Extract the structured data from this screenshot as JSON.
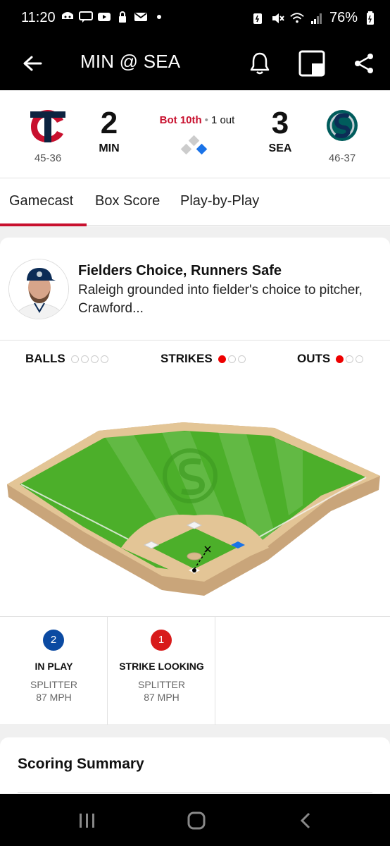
{
  "status_bar": {
    "time": "11:20",
    "battery": "76%"
  },
  "header": {
    "title": "MIN @ SEA"
  },
  "scoreboard": {
    "away": {
      "abbr": "MIN",
      "score": "2",
      "record": "45-36"
    },
    "home": {
      "abbr": "SEA",
      "score": "3",
      "record": "46-37"
    },
    "inning": "Bot 10th",
    "outs_text": "1 out",
    "bases": {
      "first": true,
      "second": false,
      "third": false
    }
  },
  "tabs": [
    {
      "label": "Gamecast",
      "active": true
    },
    {
      "label": "Box Score",
      "active": false
    },
    {
      "label": "Play-by-Play",
      "active": false
    }
  ],
  "play": {
    "title": "Fielders Choice, Runners Safe",
    "description": "Raleigh grounded into fielder's choice to pitcher, Crawford..."
  },
  "count": {
    "balls_label": "BALLS",
    "balls": 0,
    "balls_max": 4,
    "strikes_label": "STRIKES",
    "strikes": 1,
    "strikes_max": 3,
    "outs_label": "OUTS",
    "outs": 1,
    "outs_max": 3
  },
  "pitches": [
    {
      "number": "2",
      "result": "IN PLAY",
      "type": "SPLITTER",
      "speed": "87 MPH",
      "color": "#0b4aa2"
    },
    {
      "number": "1",
      "result": "STRIKE LOOKING",
      "type": "SPLITTER",
      "speed": "87 MPH",
      "color": "#d81b1b"
    }
  ],
  "summary": {
    "title": "Scoring Summary"
  },
  "colors": {
    "accent": "#c8102e",
    "field_green": "#4caf2a",
    "dirt": "#d9b98c",
    "runner_base": "#1a73e8"
  },
  "icons": [
    "back-arrow-icon",
    "bell-icon",
    "picture-in-picture-icon",
    "share-icon",
    "twins-logo-icon",
    "mariners-logo-icon",
    "player-avatar"
  ]
}
